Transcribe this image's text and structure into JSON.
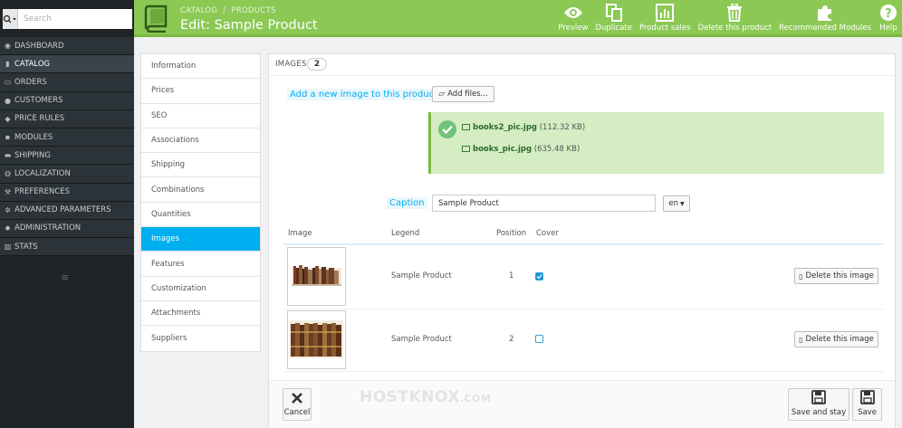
{
  "sidebar": {
    "search_placeholder": "Search",
    "items": [
      {
        "label": "DASHBOARD",
        "icon": "dashboard-icon"
      },
      {
        "label": "CATALOG",
        "icon": "book-icon"
      },
      {
        "label": "ORDERS",
        "icon": "credit-card-icon"
      },
      {
        "label": "CUSTOMERS",
        "icon": "users-icon"
      },
      {
        "label": "PRICE RULES",
        "icon": "tag-icon"
      },
      {
        "label": "MODULES",
        "icon": "puzzle-icon"
      },
      {
        "label": "SHIPPING",
        "icon": "truck-icon"
      },
      {
        "label": "LOCALIZATION",
        "icon": "globe-icon"
      },
      {
        "label": "PREFERENCES",
        "icon": "wrench-icon"
      },
      {
        "label": "ADVANCED PARAMETERS",
        "icon": "cogs-icon"
      },
      {
        "label": "ADMINISTRATION",
        "icon": "cog-icon"
      },
      {
        "label": "STATS",
        "icon": "chart-icon"
      }
    ]
  },
  "header": {
    "breadcrumb": [
      "CATALOG",
      "/",
      "PRODUCTS"
    ],
    "title": "Edit: Sample Product",
    "toolbar": [
      {
        "label": "Preview",
        "icon": "eye-icon"
      },
      {
        "label": "Duplicate",
        "icon": "copy-icon"
      },
      {
        "label": "Product sales",
        "icon": "bar-chart-icon"
      },
      {
        "label": "Delete this product",
        "icon": "trash-icon"
      },
      {
        "label": "Recommended Modules",
        "icon": "puzzle-icon"
      },
      {
        "label": "Help",
        "icon": "help-icon"
      }
    ]
  },
  "tabs": [
    "Information",
    "Prices",
    "SEO",
    "Associations",
    "Shipping",
    "Combinations",
    "Quantities",
    "Images",
    "Features",
    "Customization",
    "Attachments",
    "Suppliers"
  ],
  "panel": {
    "title": "IMAGES",
    "count": "2",
    "add_label": "Add a new image to this product",
    "add_files": "Add files...",
    "uploads": [
      {
        "name": "books2_pic.jpg",
        "size": "(112.32 KB)"
      },
      {
        "name": "books_pic.jpg",
        "size": "(635.48 KB)"
      }
    ],
    "caption_label": "Caption",
    "caption_value": "Sample Product",
    "lang": "en",
    "columns": {
      "image": "Image",
      "legend": "Legend",
      "position": "Position",
      "cover": "Cover"
    },
    "rows": [
      {
        "legend": "Sample Product",
        "position": "1",
        "cover": true,
        "delete": "Delete this image"
      },
      {
        "legend": "Sample Product",
        "position": "2",
        "cover": false,
        "delete": "Delete this image"
      }
    ],
    "footer": {
      "cancel": "Cancel",
      "save_stay": "Save and stay",
      "save": "Save"
    },
    "watermark": "HOSTKNOX",
    "watermark_suffix": ".COM"
  },
  "colors": {
    "header": "#8bc954",
    "accent": "#00aff0",
    "sidebar": "#2b3338"
  }
}
